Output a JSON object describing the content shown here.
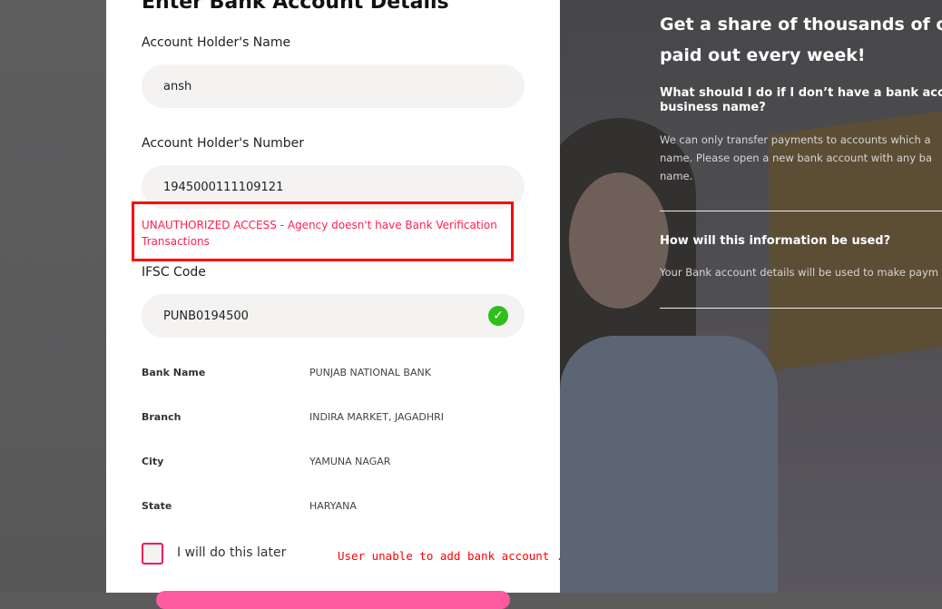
{
  "form": {
    "title": "Enter Bank Account Details",
    "name_label": "Account Holder's Name",
    "name_value": "ansh",
    "number_label": "Account Holder's Number",
    "number_value": "1945000111109121",
    "error": "UNAUTHORIZED ACCESS - Agency doesn't have Bank Verification Transactions",
    "ifsc_label": "IFSC Code",
    "ifsc_value": "PUNB0194500",
    "details": [
      {
        "key": "Bank Name",
        "value": "PUNJAB NATIONAL BANK"
      },
      {
        "key": "Branch",
        "value": "INDIRA MARKET, JAGADHRI"
      },
      {
        "key": "City",
        "value": "YAMUNA NAGAR"
      },
      {
        "key": "State",
        "value": "HARYANA"
      }
    ],
    "later_label": "I will do this later",
    "annotation": "User unable to add bank account ."
  },
  "info": {
    "headline_1": "Get a share of thousands of cro",
    "headline_2": "paid out every week!",
    "q1_1": "What should I do if I don’t have a bank accou",
    "q1_2": "business name?",
    "a1_1": "We can only transfer payments to accounts which a",
    "a1_2": "name. Please open a new bank account with any ba",
    "a1_3": "name.",
    "q2": "How will this information be used?",
    "a2": "Your Bank account details will be used to make paym"
  }
}
